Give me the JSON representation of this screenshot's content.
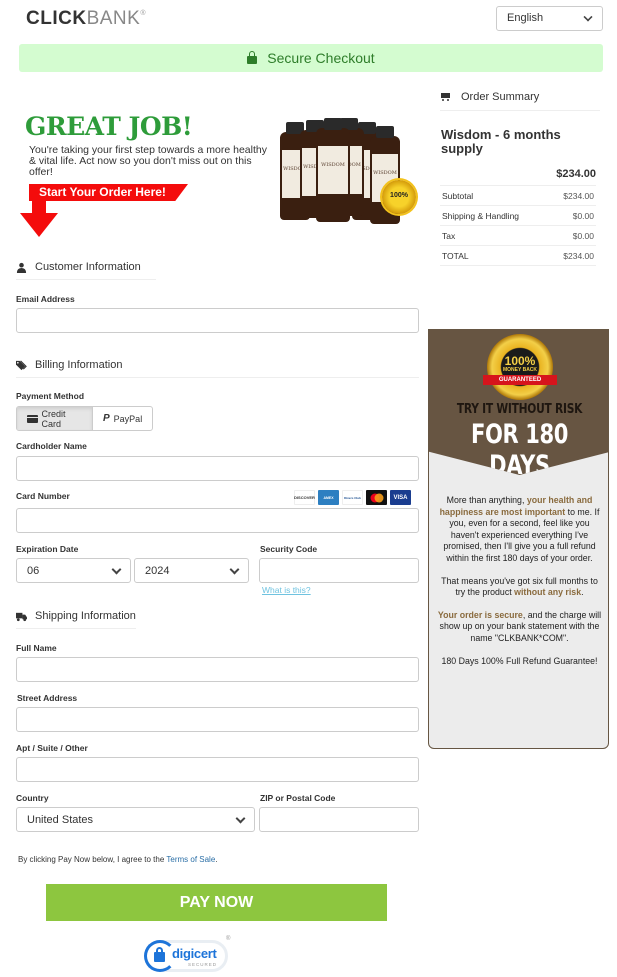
{
  "header": {
    "logo_bold": "CLICK",
    "logo_light": "BANK",
    "logo_mark": "®",
    "language": "English",
    "secure_label": "Secure Checkout"
  },
  "hero": {
    "title": "GREAT JOB!",
    "text": "You're taking your first step towards a more healthy & vital life. Act now so you don't miss out on this offer!",
    "banner": "Start Your Order Here!",
    "product_label": "WISDOM"
  },
  "customer": {
    "heading": "Customer Information",
    "email_label": "Email Address",
    "email_value": ""
  },
  "billing": {
    "heading": "Billing Information",
    "payment_method_label": "Payment Method",
    "methods": [
      "Credit Card",
      "PayPal"
    ],
    "selected_method": "Credit Card",
    "cardholder_label": "Cardholder Name",
    "card_number_label": "Card Number",
    "card_brands": [
      "DISCOVER",
      "AMEX",
      "Diners Club",
      "Mastercard",
      "VISA"
    ],
    "expiration_label": "Expiration Date",
    "exp_month": "06",
    "exp_year": "2024",
    "security_label": "Security Code",
    "what_is_this": "What is this?"
  },
  "shipping": {
    "heading": "Shipping Information",
    "full_name_label": "Full Name",
    "street_label": "Street Address",
    "apt_label": "Apt / Suite / Other",
    "country_label": "Country",
    "country_value": "United States",
    "zip_label": "ZIP or Postal Code"
  },
  "footer": {
    "terms_prefix": "By clicking Pay Now below, I agree to the ",
    "terms_link": "Terms of Sale",
    "terms_suffix": ".",
    "pay_button": "PAY NOW",
    "seal_name": "digicert",
    "seal_sub": "SECURED"
  },
  "summary": {
    "heading": "Order Summary",
    "product_name": "Wisdom - 6 months supply",
    "product_price": "$234.00",
    "rows": [
      {
        "label": "Subtotal",
        "value": "$234.00"
      },
      {
        "label": "Shipping & Handling",
        "value": "$0.00"
      },
      {
        "label": "Tax",
        "value": "$0.00"
      },
      {
        "label": "TOTAL",
        "value": "$234.00"
      }
    ]
  },
  "guarantee": {
    "badge_pct": "100%",
    "badge_text": "MONEY BACK",
    "badge_ribbon": "GUARANTEED",
    "line1": "TRY IT WITHOUT RISK",
    "line2": "FOR 180 DAYS",
    "p1_a": "More than anything, ",
    "p1_hl": "your health and happiness are most important",
    "p1_b": " to me. If you, even for a second, feel like you haven't experienced everything I've promised, then I'll give you a full refund within the first 180 days of your order.",
    "p2_a": "That means you've got six full months to try the product ",
    "p2_hl": "without any risk",
    "p2_b": ".",
    "p3_hl": "Your order is secure",
    "p3_b": ", and the charge will show up on your bank statement with the name \"CLKBANK*COM\".",
    "p4": "180 Days 100% Full Refund Guarantee!"
  }
}
